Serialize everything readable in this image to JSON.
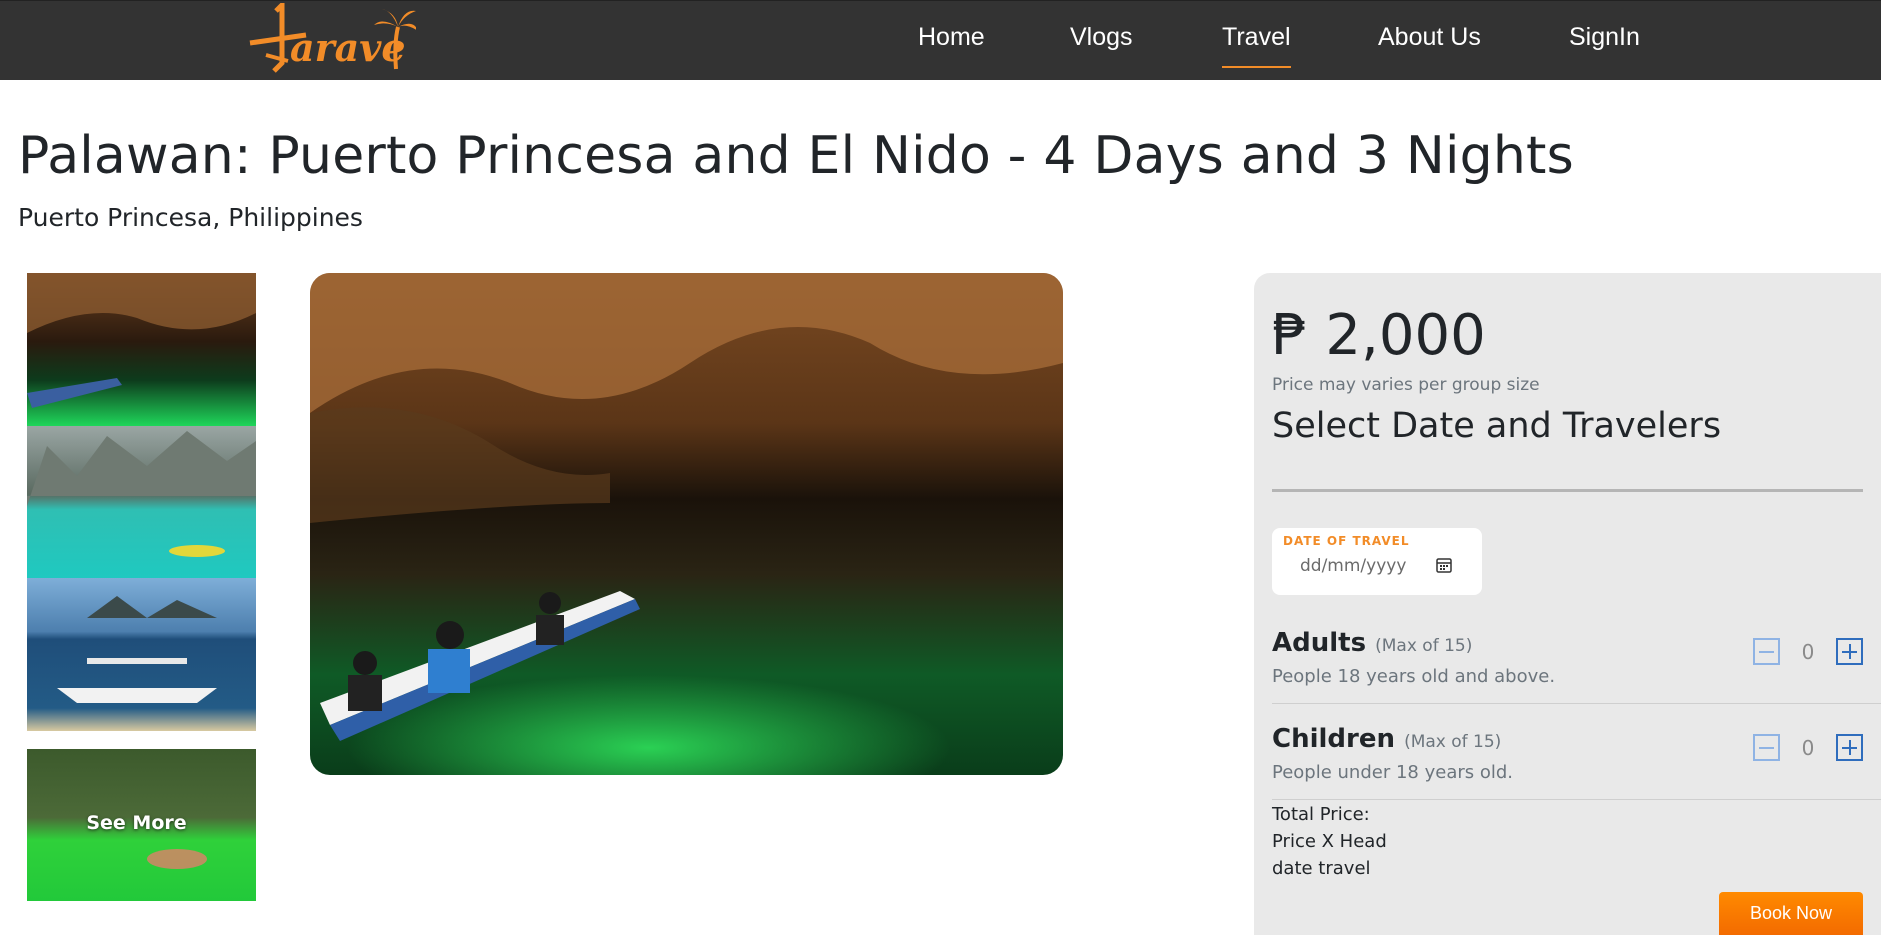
{
  "brand": {
    "logo_text": "Tarave",
    "accent_color": "#f28c28"
  },
  "nav": {
    "items": [
      {
        "label": "Home"
      },
      {
        "label": "Vlogs"
      },
      {
        "label": "Travel",
        "active": true
      },
      {
        "label": "About Us"
      },
      {
        "label": "SignIn"
      }
    ]
  },
  "tour": {
    "title": "Palawan: Puerto Princesa and El Nido - 4 Days and 3 Nights",
    "location": "Puerto Princesa, Philippines"
  },
  "gallery": {
    "see_more_label": "See More"
  },
  "booking": {
    "price": "₱ 2,000",
    "price_note": "Price may varies per group size",
    "heading": "Select Date and Travelers",
    "date_label": "DATE OF TRAVEL",
    "date_placeholder": "dd/mm/yyyy",
    "adults": {
      "label": "Adults",
      "max": "(Max of 15)",
      "desc": "People 18 years old and above.",
      "value": "0"
    },
    "children": {
      "label": "Children",
      "max": "(Max of 15)",
      "desc": "People under 18 years old.",
      "value": "0"
    },
    "total_label": "Total Price:",
    "total_formula": "Price X Head",
    "total_date": "date travel",
    "book_label": "Book Now"
  }
}
